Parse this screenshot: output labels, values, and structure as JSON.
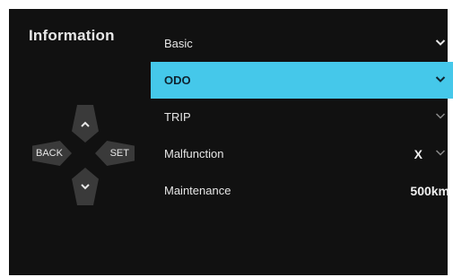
{
  "title": "Information",
  "menu": {
    "items": [
      {
        "label": "Basic",
        "value": "",
        "chevron": "chevron-down-icon"
      },
      {
        "label": "ODO",
        "value": "",
        "chevron": "chevron-down-icon"
      },
      {
        "label": "TRIP",
        "value": "",
        "chevron": "chevron-down-icon"
      },
      {
        "label": "Malfunction",
        "value": "X",
        "chevron": "chevron-down-icon"
      },
      {
        "label": "Maintenance",
        "value": "500km",
        "chevron": ""
      }
    ],
    "selected_index": 1
  },
  "dpad": {
    "up_icon": "chevron-up-icon",
    "down_icon": "chevron-down-icon",
    "left_label": "BACK",
    "right_label": "SET"
  },
  "colors": {
    "background": "#111111",
    "highlight": "#45c8ea",
    "key": "#3a3a3a",
    "text": "#e6e6e6"
  }
}
